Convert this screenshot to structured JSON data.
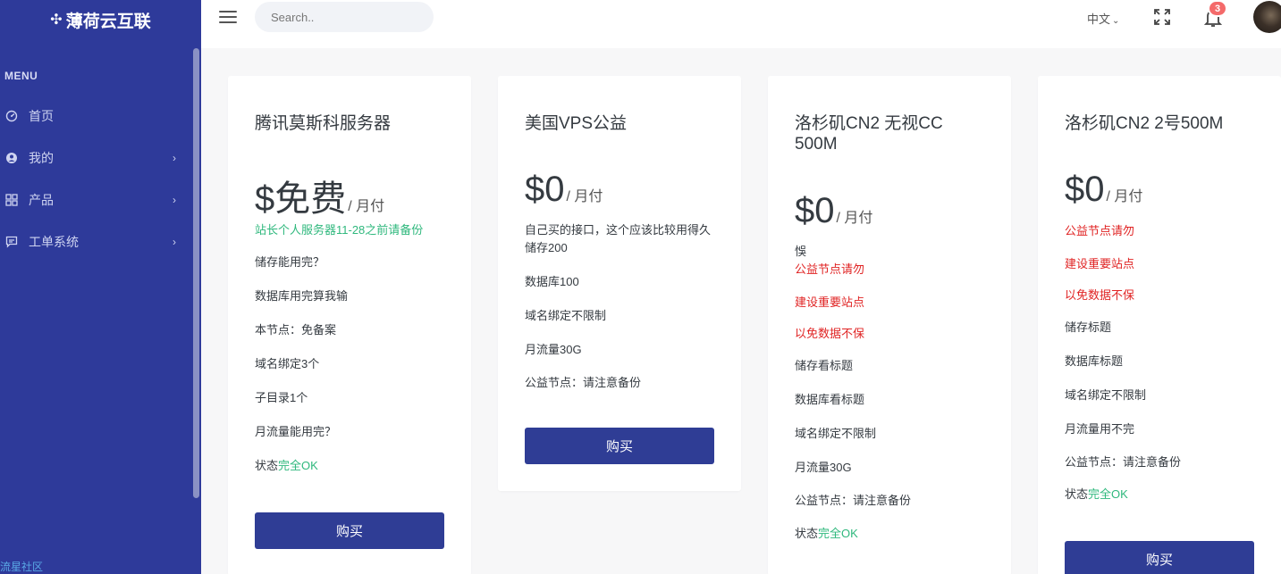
{
  "sidebar": {
    "brand": "薄荷云互联",
    "menu_title": "MENU",
    "items": [
      {
        "label": "首页",
        "has_children": false
      },
      {
        "label": "我的",
        "has_children": true
      },
      {
        "label": "产品",
        "has_children": true
      },
      {
        "label": "工单系统",
        "has_children": true
      }
    ],
    "footer": "流星社区"
  },
  "topbar": {
    "search_placeholder": "Search..",
    "language": "中文",
    "notification_count": "3"
  },
  "plans": [
    {
      "title": "腾讯莫斯科服务器",
      "price": "$免费",
      "period": "/ 月付",
      "buy_label": "购买"
    },
    {
      "title": "美国VPS公益",
      "price": "$0",
      "period": "/ 月付",
      "buy_label": "购买"
    },
    {
      "title_line1": "洛杉矶CN2 无视CC",
      "title_line2": "500M",
      "price": "$0",
      "period": "/ 月付",
      "buy_label": "购买"
    },
    {
      "title": "洛杉矶CN2 2号500M",
      "price": "$0",
      "period": "/ 月付",
      "buy_label": "购买"
    }
  ],
  "features": {
    "p1": {
      "f1": "站长个人服务器11-28之前请备份",
      "f2": "储存能用完？",
      "f3": "数据库用完算我输",
      "f4": "本节点：免备案",
      "f5": "域名绑定3个",
      "f6": "子目录1个",
      "f7": "月流量能用完？",
      "f8_prefix": "状态",
      "f8_status": "完全OK"
    },
    "p2": {
      "f1a": "自己买的接口，这个应该比较用得久",
      "f1b": "储存200",
      "f2": "数据库100",
      "f3": "域名绑定不限制",
      "f4": "月流量30G",
      "f5": "公益节点：请注意备份"
    },
    "p3": {
      "f0": "悞",
      "f1": "公益节点请勿",
      "f2": "建设重要站点",
      "f3": "以免数据不保",
      "f4": "储存看标题",
      "f5": "数据库看标题",
      "f6": "域名绑定不限制",
      "f7": "月流量30G",
      "f8": "公益节点：请注意备份",
      "f9_prefix": "状态",
      "f9_status": "完全OK"
    },
    "p4": {
      "f1": "公益节点请勿",
      "f2": "建设重要站点",
      "f3": "以免数据不保",
      "f4": "储存标题",
      "f5": "数据库标题",
      "f6": "域名绑定不限制",
      "f7": "月流量用不完",
      "f8": "公益节点：请注意备份",
      "f9_prefix": "状态",
      "f9_status": "完全OK"
    }
  },
  "colors": {
    "sidebar_bg": "#2e3a9a",
    "button_bg": "#2f3d95",
    "status_green": "#2fb87d",
    "warning_red": "#e02424",
    "badge_red": "#f46a6a"
  }
}
